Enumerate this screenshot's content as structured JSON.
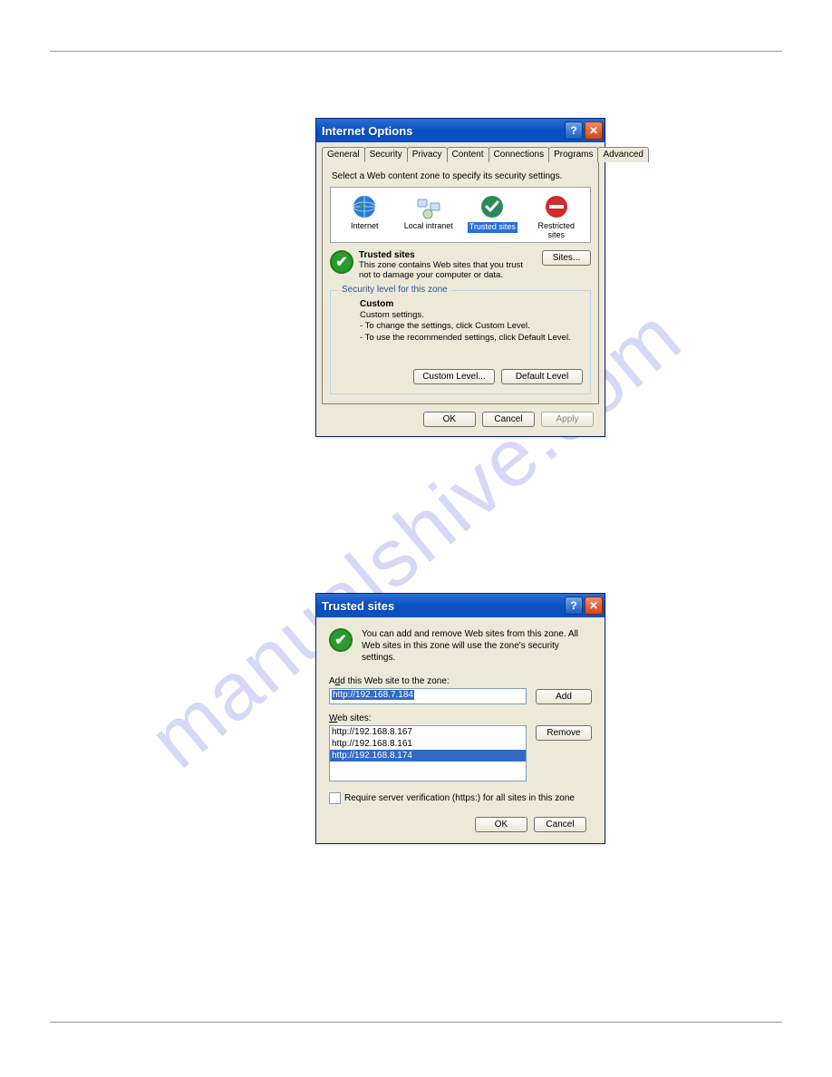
{
  "watermark": "manualshive.com",
  "dialog1": {
    "title": "Internet Options",
    "tabs": [
      "General",
      "Security",
      "Privacy",
      "Content",
      "Connections",
      "Programs",
      "Advanced"
    ],
    "active_tab": "Security",
    "instruction": "Select a Web content zone to specify its security settings.",
    "zones": {
      "internet": "Internet",
      "local": "Local intranet",
      "trusted": "Trusted sites",
      "restricted_line1": "Restricted",
      "restricted_line2": "sites"
    },
    "trusted_heading": "Trusted sites",
    "trusted_desc": "This zone contains Web sites that you trust not to damage your computer or data.",
    "sites_btn": "Sites...",
    "security_legend": "Security level for this zone",
    "custom_heading": "Custom",
    "custom_line1": "Custom settings.",
    "custom_line2": "- To change the settings, click Custom Level.",
    "custom_line3": "- To use the recommended settings, click Default Level.",
    "custom_level_btn": "Custom Level...",
    "default_level_btn": "Default Level",
    "ok_btn": "OK",
    "cancel_btn": "Cancel",
    "apply_btn": "Apply"
  },
  "dialog2": {
    "title": "Trusted sites",
    "info": "You can add and remove Web sites from this zone. All Web sites in this zone will use the zone's security settings.",
    "add_label_pre": "A",
    "add_label_ul": "d",
    "add_label_post": "d this Web site to the zone:",
    "input_value": "http://192.168.7.184",
    "add_btn": "Add",
    "websites_label_ul": "W",
    "websites_label_post": "eb sites:",
    "list": [
      "http://192.168.8.167",
      "http://192.168.8.161",
      "http://192.168.8.174"
    ],
    "list_selected_index": 2,
    "remove_btn": "Remove",
    "checkbox_label": "Require server verification (https:) for all sites in this zone",
    "ok_btn": "OK",
    "cancel_btn": "Cancel"
  }
}
